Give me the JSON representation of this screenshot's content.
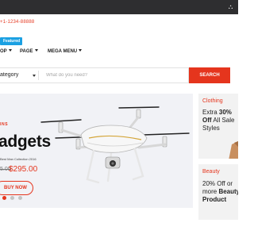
{
  "topbar": {
    "icon": "translate-icon",
    "background": "#2e2e30"
  },
  "header": {
    "phone": "+1-1234-88888",
    "badge": "Featured"
  },
  "nav": {
    "items": [
      {
        "label": "OP"
      },
      {
        "label": "PAGE"
      },
      {
        "label": "MEGA MENU"
      }
    ]
  },
  "search": {
    "category": "ategory",
    "placeholder": "What do you need?",
    "button": "SEARCH"
  },
  "hero": {
    "eyebrow": "INS",
    "title": "adgets",
    "subtitle": "Best Man Collection 2016",
    "old_price": "5.00",
    "price": "$295.00",
    "button": "BUY NOW",
    "image": "drone-image",
    "dots": 3,
    "active_dot": 0
  },
  "promos": [
    {
      "title": "Clothing",
      "lines": [
        {
          "plain": "Extra ",
          "bold": "30%"
        },
        {
          "plain": "",
          "bold": "Off",
          "after": " All Sale"
        },
        {
          "plain": "Styles",
          "bold": ""
        }
      ]
    },
    {
      "title": "Beauty",
      "lines": [
        {
          "plain": "20% Off or",
          "bold": ""
        },
        {
          "plain": "more ",
          "bold": "Beauty"
        },
        {
          "plain": "",
          "bold": "Product"
        }
      ]
    }
  ],
  "colors": {
    "accent": "#e5351d",
    "badge": "#1ba0e2",
    "hero_bg": "#f1f2f6",
    "promo_bg": "#f2f2f2"
  }
}
